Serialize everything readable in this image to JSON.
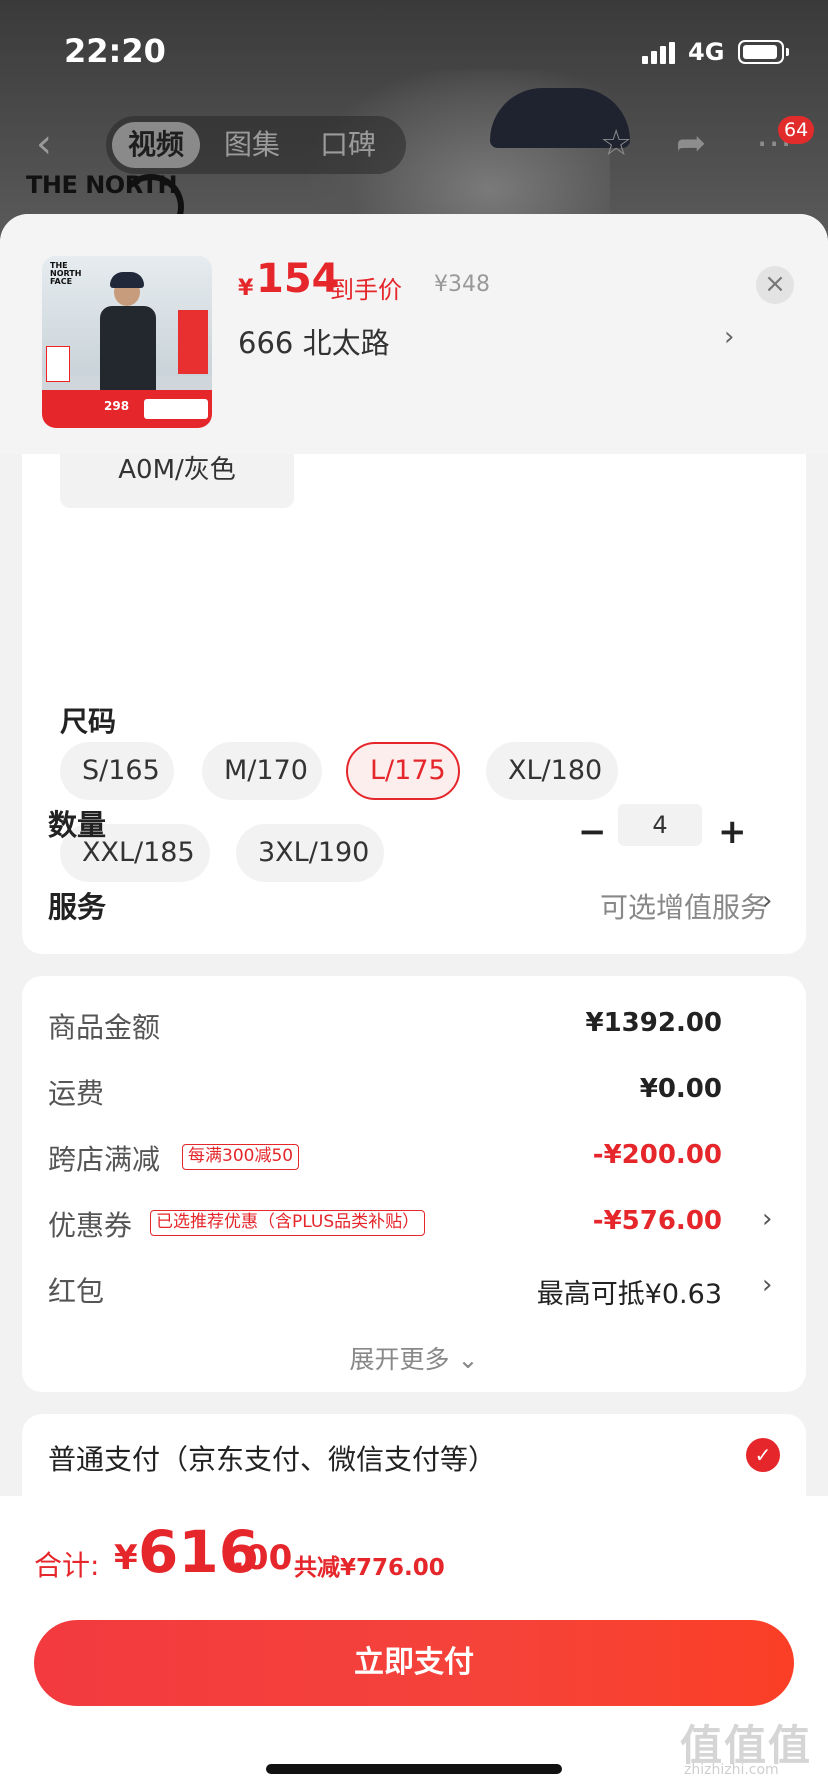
{
  "status_bar": {
    "time": "22:20",
    "network": "4G"
  },
  "nav": {
    "tabs": [
      {
        "label": "视频",
        "active": true
      },
      {
        "label": "图集",
        "active": false
      },
      {
        "label": "口碑",
        "active": false
      }
    ],
    "badge": "64",
    "background_logo": "THE NORTH"
  },
  "product": {
    "currency": "¥",
    "price": "154",
    "price_tag": "到手价",
    "original_price": "¥348",
    "selected_spec": "666  北太路",
    "thumb_price": "298"
  },
  "options": {
    "color_chip": "A0M/灰色",
    "size_title": "尺码",
    "sizes": [
      {
        "label": "S/165",
        "selected": false
      },
      {
        "label": "M/170",
        "selected": false
      },
      {
        "label": "L/175",
        "selected": true
      },
      {
        "label": "XL/180",
        "selected": false
      },
      {
        "label": "XXL/185",
        "selected": false
      },
      {
        "label": "3XL/190",
        "selected": false
      }
    ],
    "quantity_label": "数量",
    "quantity": "4",
    "service_label": "服务",
    "service_value": "可选增值服务"
  },
  "pricing": {
    "rows": [
      {
        "label": "商品金额",
        "value": "¥1392.00",
        "tag": ""
      },
      {
        "label": "运费",
        "value": "¥0.00",
        "tag": ""
      },
      {
        "label": "跨店满减",
        "value": "-¥200.00",
        "tag": "每满300减50"
      },
      {
        "label": "优惠券",
        "value": "-¥576.00",
        "tag": "已选推荐优惠（含PLUS品类补贴）"
      },
      {
        "label": "红包",
        "value": "最高可抵¥0.63",
        "tag": ""
      }
    ],
    "expand_more": "展开更多"
  },
  "payment": {
    "method": "普通支付（京东支付、微信支付等）"
  },
  "bottom": {
    "total_label": "合计:",
    "currency": "¥",
    "total_integer": "616",
    "total_decimal": ".00",
    "total_saved": "共减¥776.00",
    "pay_button": "立即支付"
  },
  "watermark": {
    "main": "值值值",
    "sub": "zhizhizhi.com"
  },
  "colors": {
    "accent": "#e5262b",
    "card": "#ffffff",
    "page_bg": "#f2f2f2"
  },
  "icons": [
    "back-icon",
    "star-icon",
    "share-icon",
    "more-icon",
    "close-icon",
    "chevron-right-icon",
    "minus-icon",
    "plus-icon",
    "check-icon",
    "chevron-down-icon"
  ]
}
